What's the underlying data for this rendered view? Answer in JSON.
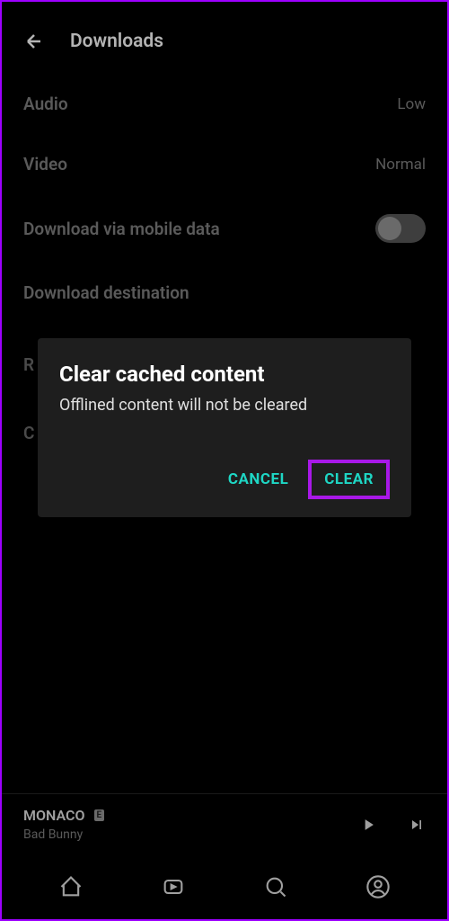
{
  "header": {
    "title": "Downloads"
  },
  "settings": {
    "audio": {
      "label": "Audio",
      "value": "Low"
    },
    "video": {
      "label": "Video",
      "value": "Normal"
    },
    "mobile_data": {
      "label": "Download via mobile data"
    },
    "destination": {
      "label": "Download destination"
    },
    "partial_r": "R",
    "partial_c": "C"
  },
  "dialog": {
    "title": "Clear cached content",
    "message": "Offlined content will not be cleared",
    "cancel": "CANCEL",
    "clear": "CLEAR"
  },
  "now_playing": {
    "track": "MONACO",
    "explicit": "E",
    "artist": "Bad Bunny"
  }
}
